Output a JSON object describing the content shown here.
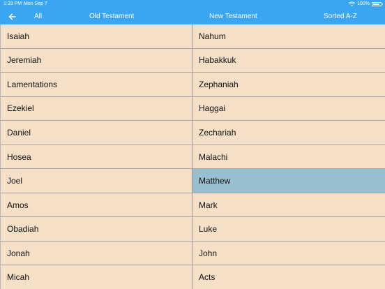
{
  "status": {
    "time": "1:33 PM",
    "date": "Mon Sep 7",
    "battery": "100%",
    "icons": [
      "wifi-icon",
      "battery-icon"
    ]
  },
  "nav": {
    "back_icon": "arrow-left-icon",
    "all": "All",
    "old_testament": "Old Testament",
    "new_testament": "New Testament",
    "sorted": "Sorted A-Z"
  },
  "old_testament": [
    "Isaiah",
    "Jeremiah",
    "Lamentations",
    "Ezekiel",
    "Daniel",
    "Hosea",
    "Joel",
    "Amos",
    "Obadiah",
    "Jonah",
    "Micah"
  ],
  "new_testament": [
    "Nahum",
    "Habakkuk",
    "Zephaniah",
    "Haggai",
    "Zechariah",
    "Malachi",
    "Matthew",
    "Mark",
    "Luke",
    "John",
    "Acts"
  ],
  "selected": "Matthew",
  "colors": {
    "header": "#3aa6f2",
    "cell": "#f5dfc7",
    "selected_cell": "#97bfcf"
  }
}
